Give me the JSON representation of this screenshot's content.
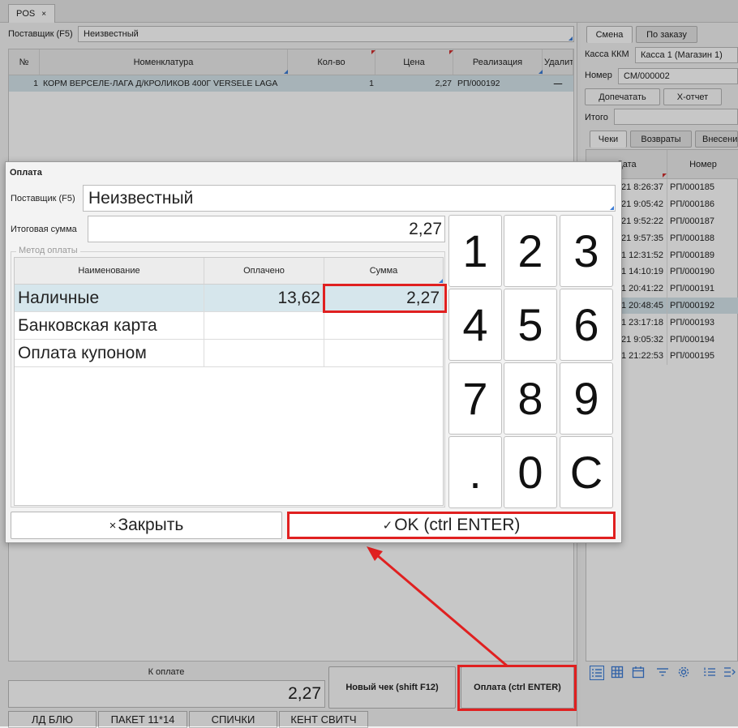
{
  "window": {
    "tab_title": "POS",
    "tab_close": "×"
  },
  "main": {
    "supplier_label": "Поставщик (F5)",
    "supplier_value": "Неизвестный",
    "table": {
      "headers": [
        "№",
        "Номенклатура",
        "Кол-во",
        "Цена",
        "Реализация",
        "Удалить"
      ],
      "rows": [
        {
          "num": "1",
          "name": "КОРМ ВЕРСЕЛЕ-ЛАГА Д/КРОЛИКОВ 400Г VERSELE LAGA",
          "qty": "1",
          "price": "2,27",
          "doc": "РП/000192",
          "delete": "—"
        }
      ]
    },
    "to_pay_label": "К оплате",
    "to_pay_value": "2,27",
    "new_check_button": "Новый чек (shift F12)",
    "pay_button": "Оплата (ctrl ENTER)",
    "quick_buttons": [
      "ЛД БЛЮ",
      "ПАКЕТ 11*14",
      "СПИЧКИ",
      "КЕНТ СВИТЧ"
    ]
  },
  "right": {
    "tabs": [
      "Смена",
      "По заказу"
    ],
    "kkm_label": "Касса ККМ",
    "kkm_value": "Касса 1 (Магазин 1)",
    "number_label": "Номер",
    "number_value": "СМ/000002",
    "reprint_button": "Допечатать",
    "x_report_button": "Х-отчет",
    "total_label": "Итого",
    "subtabs": [
      "Чеки",
      "Возвраты",
      "Внесени"
    ],
    "list_headers": [
      "Дата",
      "Номер"
    ],
    "list_rows": [
      {
        "date": "21 8:26:37",
        "num": "РП/000185"
      },
      {
        "date": "21 9:05:42",
        "num": "РП/000186"
      },
      {
        "date": "21 9:52:22",
        "num": "РП/000187"
      },
      {
        "date": "21 9:57:35",
        "num": "РП/000188"
      },
      {
        "date": "1 12:31:52",
        "num": "РП/000189"
      },
      {
        "date": "1 14:10:19",
        "num": "РП/000190"
      },
      {
        "date": "1 20:41:22",
        "num": "РП/000191"
      },
      {
        "date": "1 20:48:45",
        "num": "РП/000192"
      },
      {
        "date": "1 23:17:18",
        "num": "РП/000193"
      },
      {
        "date": "21 9:05:32",
        "num": "РП/000194"
      },
      {
        "date": "1 21:22:53",
        "num": "РП/000195"
      }
    ],
    "selected_row_index": 7
  },
  "dialog": {
    "title": "Оплата",
    "supplier_label": "Поставщик (F5)",
    "supplier_value": "Неизвестный",
    "total_label": "Итоговая сумма",
    "total_value": "2,27",
    "method_label": "Метод оплаты",
    "table_headers": [
      "Наименование",
      "Оплачено",
      "Сумма"
    ],
    "rows": [
      {
        "name": "Наличные",
        "paid": "13,62",
        "amount": "2,27"
      },
      {
        "name": "Банковская карта",
        "paid": "",
        "amount": ""
      },
      {
        "name": "Оплата купоном",
        "paid": "",
        "amount": ""
      }
    ],
    "keys": [
      "1",
      "2",
      "3",
      "4",
      "5",
      "6",
      "7",
      "8",
      "9",
      ".",
      "0",
      "C"
    ],
    "close_icon": "×",
    "close_label": "Закрыть",
    "ok_icon": "✓",
    "ok_label": "OK (ctrl ENTER)"
  },
  "colors": {
    "highlight": "#e02020",
    "selected_row": "#d6e6ec",
    "accent_blue": "#3a7bd5"
  }
}
